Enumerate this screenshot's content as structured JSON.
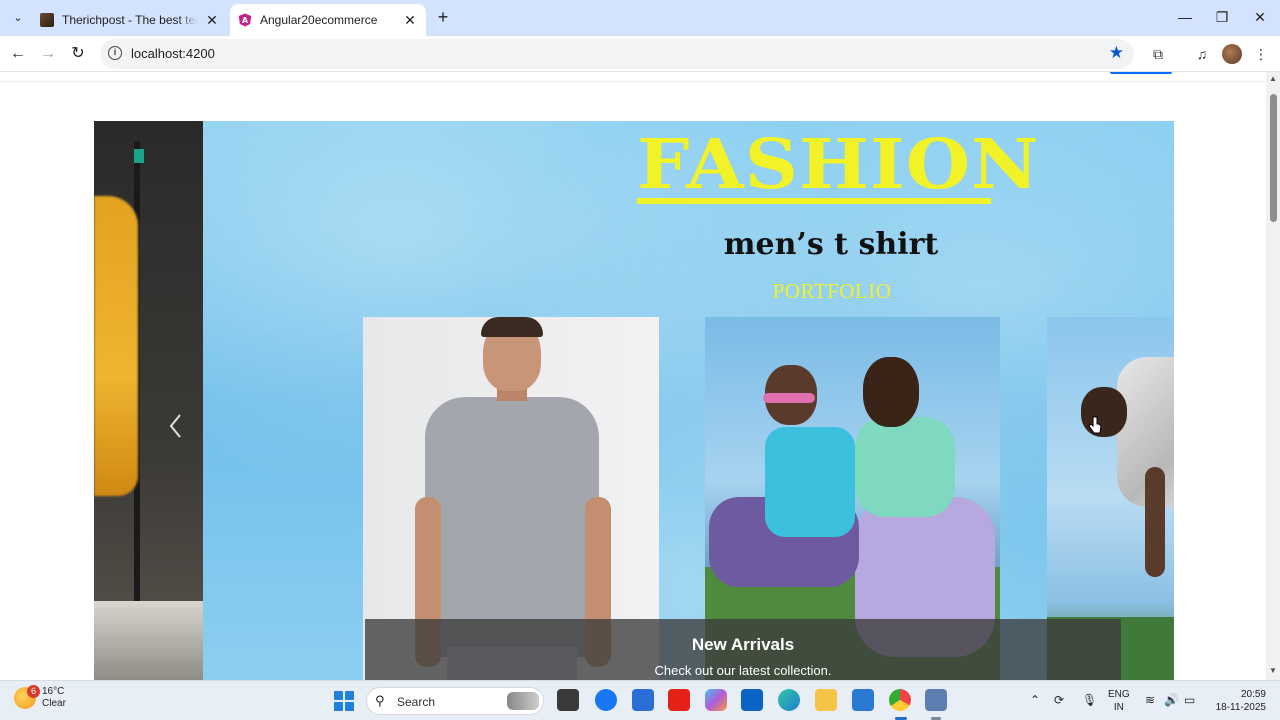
{
  "browser": {
    "tab_menu_icon": "chevron-down-icon",
    "tabs": [
      {
        "title": "Therichpost - The best tech and",
        "favicon": "therichpost-favicon",
        "active": false
      },
      {
        "title": "Angular20ecommerce",
        "favicon": "angular-favicon",
        "active": true
      }
    ],
    "close_glyph": "✕",
    "new_tab_glyph": "+",
    "window_controls": {
      "minimize": "—",
      "restore": "❐",
      "close": "✕"
    },
    "address": "localhost:4200",
    "accent_color": "#0b57d0"
  },
  "hero": {
    "heading": "FASHION",
    "subheading": "men’s t shirt",
    "tagline": "PORTFOLIO",
    "heading_color": "#f1f227",
    "prev_glyph": "‹"
  },
  "caption": {
    "title": "New Arrivals",
    "text": "Check out our latest collection."
  },
  "taskbar": {
    "weather_badge": "6",
    "temperature": "16°C",
    "condition": "Clear",
    "search_label": "Search",
    "language_line1": "ENG",
    "language_line2": "IN",
    "time": "20:59",
    "date": "18-11-2025"
  }
}
